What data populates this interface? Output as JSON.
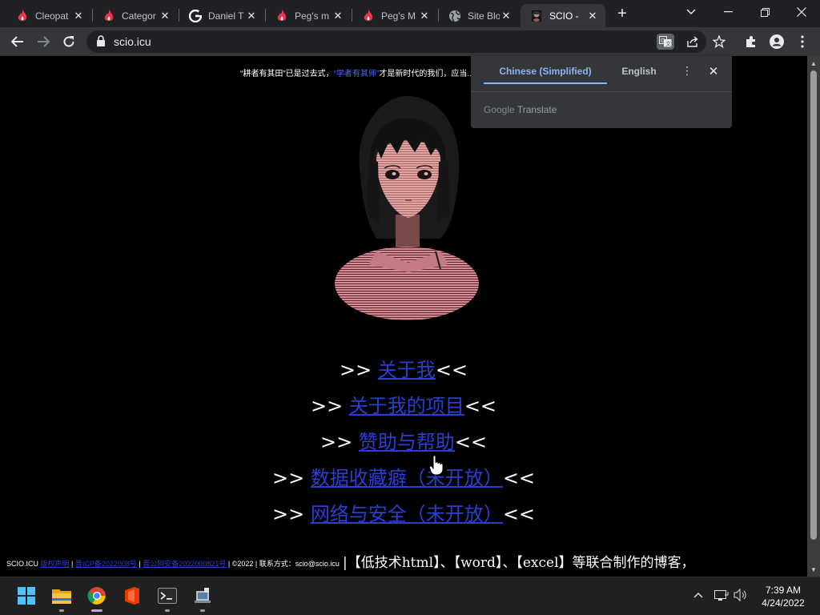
{
  "browser": {
    "tabs": [
      {
        "title": "Cleopat",
        "icon": "flame-icon"
      },
      {
        "title": "Categor",
        "icon": "flame-icon"
      },
      {
        "title": "Daniel T",
        "icon": "google-icon"
      },
      {
        "title": "Peg's m",
        "icon": "flame-icon"
      },
      {
        "title": "Peg's M",
        "icon": "flame-icon"
      },
      {
        "title": "Site Blo",
        "icon": "globe-icon"
      },
      {
        "title": "SCIO - ",
        "icon": "anime-avatar-icon",
        "active": true
      }
    ],
    "new_tab_glyph": "+",
    "url": "scio.icu"
  },
  "translate_popup": {
    "source_lang": "Chinese (Simplified)",
    "target_lang": "English",
    "brand": "Google",
    "brand_suffix": "Translate"
  },
  "page": {
    "top_quote_before": "“耕者有其田”已是过去式，",
    "top_quote_highlight": "“学者有其师”",
    "top_quote_after": "才是新时代的我们，应当...",
    "menu": [
      {
        "prefix": ">> ",
        "link": "关于我",
        "suffix": "<<"
      },
      {
        "prefix": ">> ",
        "link": "关于我的项目",
        "suffix": "<<"
      },
      {
        "prefix": ">> ",
        "link": "赞助与帮助",
        "suffix": "<<"
      },
      {
        "prefix": ">> ",
        "link": "数据收藏癖（未开放）",
        "suffix": "<<"
      },
      {
        "prefix": ">> ",
        "link": "网络与安全（未开放）",
        "suffix": "<<"
      }
    ],
    "footer": {
      "site": "SCIO.ICU",
      "link1": "版权声明",
      "sep": " | ",
      "link2": "晋ICP备2022008号",
      "link3": "晋公网安备2022000821号",
      "copyright": "©2022",
      "contact": "联系方式：scio@scio.icu",
      "big_text": "|【低技术html】、【word】、【excel】等联合制作的博客，"
    }
  },
  "taskbar": {
    "apps": [
      "windows-start-icon",
      "file-explorer-icon",
      "chrome-icon",
      "office-icon",
      "terminal-icon",
      "remote-desktop-icon"
    ],
    "time": "7:39 AM",
    "date": "4/24/2022"
  },
  "colors": {
    "link": "#2a3fd0",
    "accent": "#8ab4f8",
    "tab_bg": "#202124",
    "toolbar_bg": "#35363a"
  }
}
